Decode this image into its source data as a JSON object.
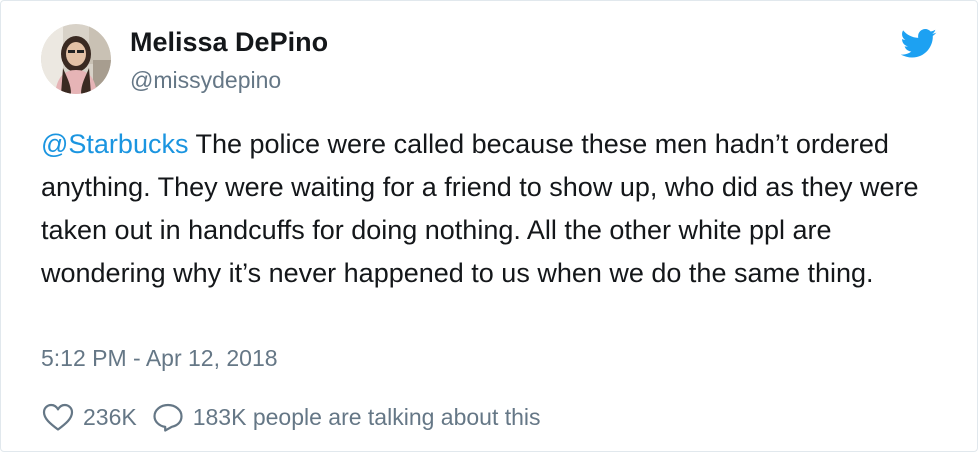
{
  "user": {
    "display_name": "Melissa DePino",
    "handle": "@missydepino"
  },
  "tweet": {
    "mention": "@Starbucks",
    "body": " The police were called because these men hadn’t ordered anything. They were waiting for a friend to show up, who did as they were taken out in handcuffs for doing nothing. All the other white ppl are wondering why it’s never happened to us when we do the same thing.",
    "timestamp": "5:12 PM - Apr 12, 2018"
  },
  "stats": {
    "likes": "236K",
    "talking": "183K people are talking about this"
  },
  "colors": {
    "twitter_blue": "#1da1f2",
    "link_blue": "#1b95e0",
    "secondary_text": "#657786",
    "primary_text": "#14171a",
    "border": "#e1e8ed"
  },
  "icons": {
    "brand": "twitter-bird-icon",
    "like": "heart-icon",
    "reply": "speech-bubble-icon"
  }
}
